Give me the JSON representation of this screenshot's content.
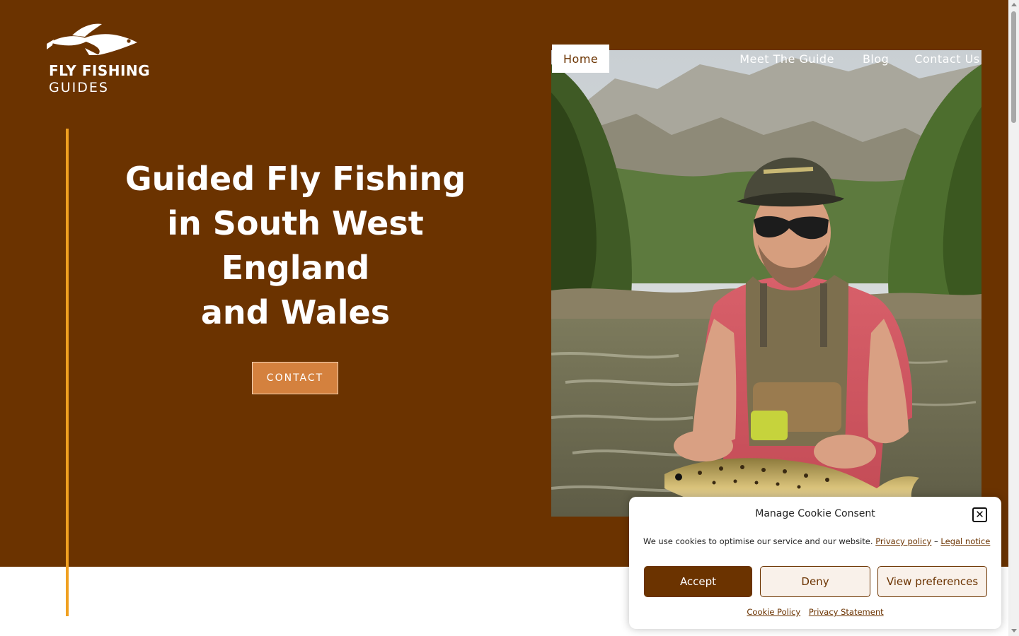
{
  "brand": {
    "line1": "FLY FISHING",
    "line2": "GUIDES"
  },
  "nav": {
    "items": [
      {
        "label": "Home",
        "active": true
      },
      {
        "label": "Meet The Guide",
        "active": false
      },
      {
        "label": "Blog",
        "active": false
      },
      {
        "label": "Contact Us",
        "active": false
      }
    ]
  },
  "hero": {
    "headline_lines": [
      "Guided Fly Fishing",
      "in South West",
      "England",
      "and Wales"
    ],
    "cta_label": "CONTACT",
    "photo_alt": "Fly fishing guide holding a brown trout in a river"
  },
  "cookie": {
    "title": "Manage Cookie Consent",
    "close_glyph": "✕",
    "message": "We use cookies to optimise our service and our website.",
    "privacy_link": "Privacy policy",
    "separator": "–",
    "legal_link": "Legal notice",
    "accept_label": "Accept",
    "deny_label": "Deny",
    "preferences_label": "View preferences",
    "cookie_policy_link": "Cookie Policy",
    "privacy_statement_link": "Privacy Statement"
  },
  "colors": {
    "hero_brown": "#6b3300",
    "accent_orange": "#f0a020",
    "cta_orange": "#d4813e"
  }
}
